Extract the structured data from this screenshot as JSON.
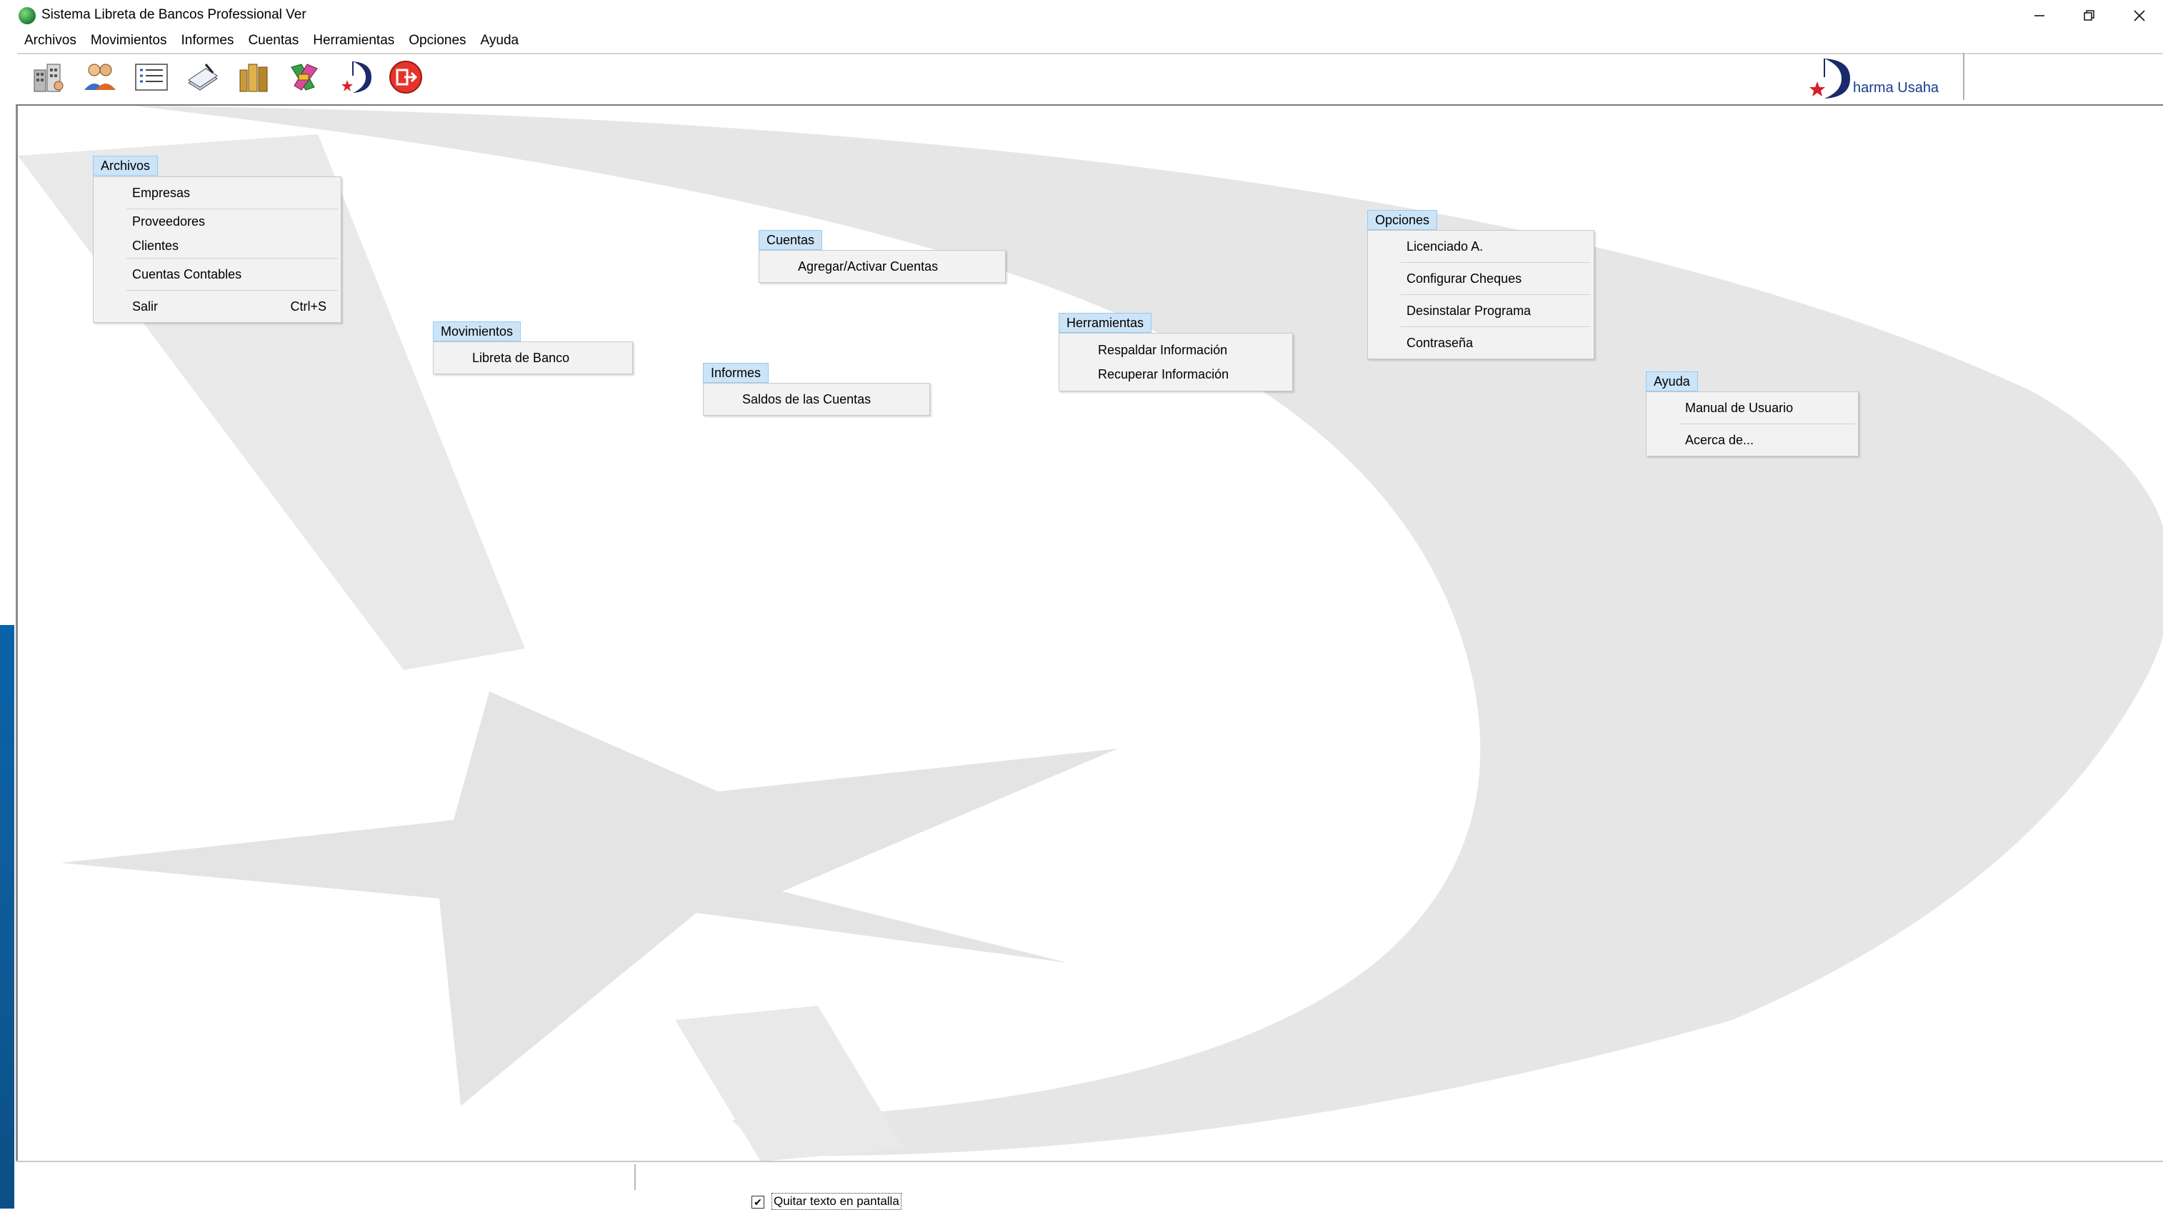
{
  "window": {
    "title": "Sistema Libreta de Bancos Professional Ver",
    "minimize_icon": "minimize-icon",
    "restore_icon": "restore-icon",
    "close_icon": "close-icon"
  },
  "menubar": [
    "Archivos",
    "Movimientos",
    "Informes",
    "Cuentas",
    "Herramientas",
    "Opciones",
    "Ayuda"
  ],
  "toolbar": {
    "buttons": [
      "company-building-icon",
      "users-icon",
      "list-icon",
      "checkbook-icon",
      "books-icon",
      "tools-icon",
      "dharma-logo-icon",
      "exit-icon"
    ],
    "brand_text": "harma Usaha"
  },
  "diagram": {
    "archivos": {
      "title": "Archivos",
      "items": [
        "Empresas",
        "Proveedores",
        "Clientes",
        "Cuentas Contables",
        "Salir"
      ],
      "salir_shortcut": "Ctrl+S"
    },
    "movimientos": {
      "title": "Movimientos",
      "items": [
        "Libreta de Banco"
      ]
    },
    "informes": {
      "title": "Informes",
      "items": [
        "Saldos de las Cuentas"
      ]
    },
    "cuentas": {
      "title": "Cuentas",
      "items": [
        "Agregar/Activar Cuentas"
      ]
    },
    "herramientas": {
      "title": "Herramientas",
      "items": [
        "Respaldar Información",
        "Recuperar Información"
      ]
    },
    "opciones": {
      "title": "Opciones",
      "items": [
        "Licenciado A.",
        "Configurar Cheques",
        "Desinstalar Programa",
        "Contraseña"
      ]
    },
    "ayuda": {
      "title": "Ayuda",
      "items": [
        "Manual de Usuario",
        "Acerca de..."
      ]
    }
  },
  "statusbar": {
    "checkbox_label": "Quitar texto en pantalla",
    "checkbox_checked": true
  },
  "colors": {
    "menu_title_bg": "#cce4f7",
    "menu_box_bg": "#f2f2f2",
    "watermark": "#e6e6e6",
    "brand_blue": "#1a3a8a"
  }
}
